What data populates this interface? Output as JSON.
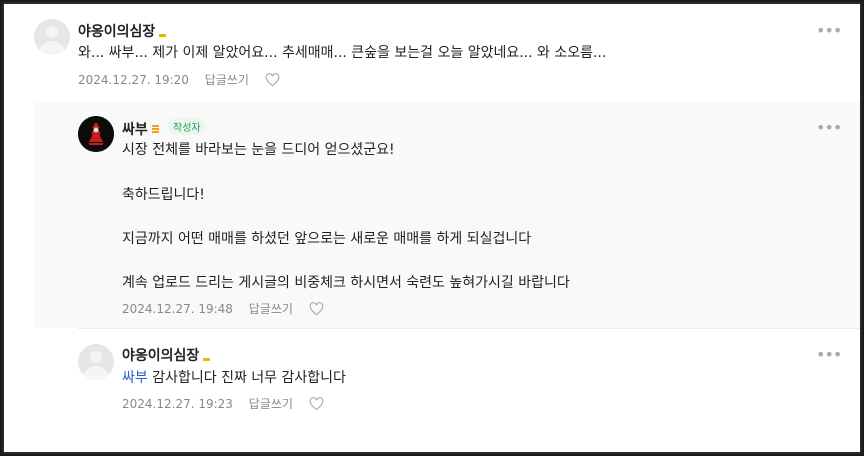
{
  "comments": [
    {
      "author": "야옹이의심장",
      "text": "와... 싸부... 제가 이제 알았어요... 추세매매... 큰숲을 보는걸 오늘 알았네요... 와 소오름...",
      "date": "2024.12.27. 19:20",
      "reply_label": "답글쓰기",
      "more": "•••"
    },
    {
      "author": "싸부",
      "author_badge": "작성자",
      "lines": [
        "시장 전체를 바라보는 눈을 드디어 얻으셨군요!",
        "축하드립니다!",
        "지금까지 어떤 매매를 하셨던 앞으로는 새로운 매매를 하게 되실겁니다",
        "계속 업로드 드리는 게시글의 비중체크 하시면서 숙련도 높혀가시길 바랍니다"
      ],
      "date": "2024.12.27. 19:48",
      "reply_label": "답글쓰기",
      "more": "•••"
    },
    {
      "author": "야옹이의심장",
      "mention": "싸부",
      "text": " 감사합니다 진짜 너무 감사합니다",
      "date": "2024.12.27. 19:23",
      "reply_label": "답글쓰기",
      "more": "•••"
    }
  ],
  "colors": {
    "mention": "#2a5bd7",
    "author_badge": "#1e9e5a",
    "level_badge": "#f1b400"
  },
  "icons": [
    "default-avatar-icon",
    "heart-icon",
    "more-options-icon",
    "level-badge-icon"
  ]
}
